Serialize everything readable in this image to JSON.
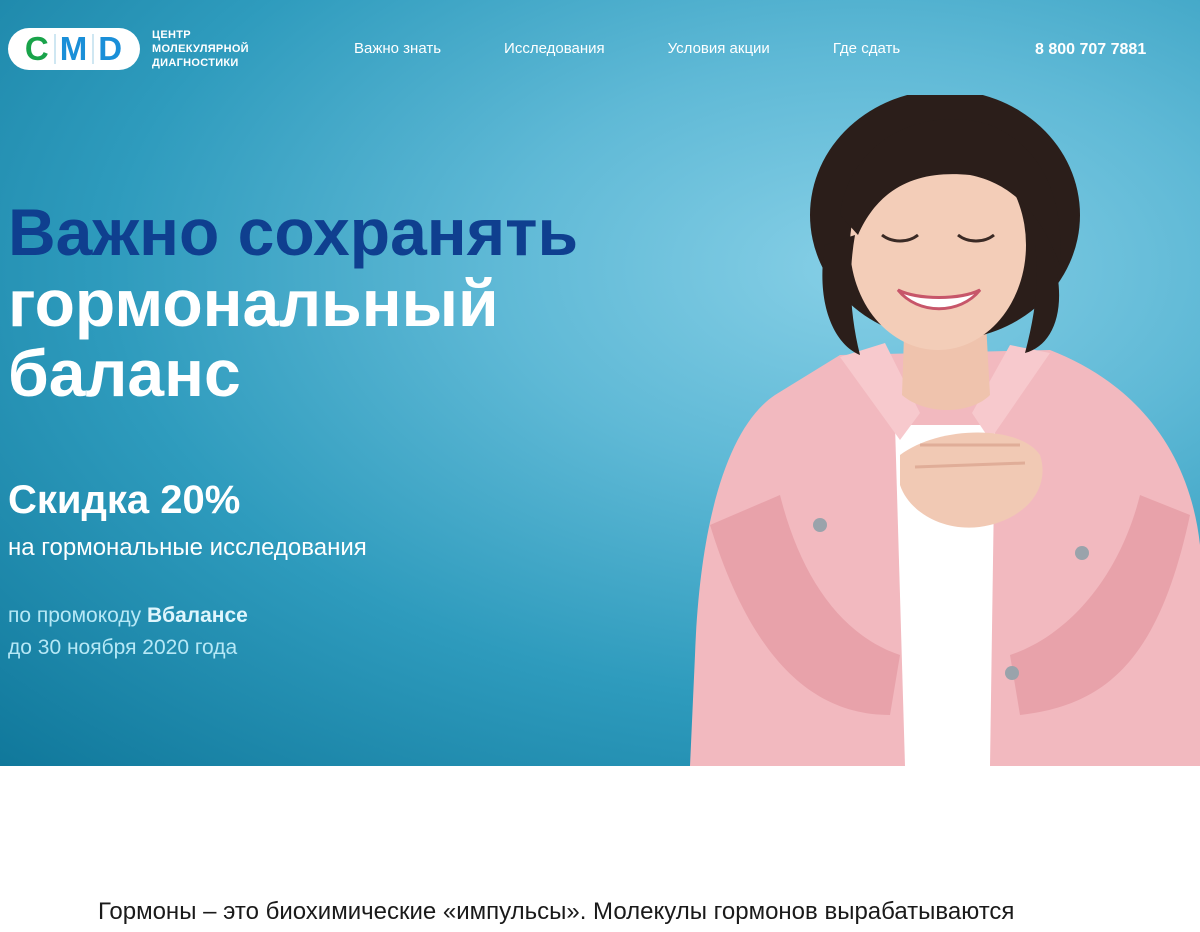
{
  "header": {
    "logo": {
      "letters": [
        "C",
        "M",
        "D"
      ],
      "lines": [
        "ЦЕНТР",
        "МОЛЕКУЛЯРНОЙ",
        "ДИАГНОСТИКИ"
      ]
    },
    "nav": [
      "Важно знать",
      "Исследования",
      "Условия акции",
      "Где сдать"
    ],
    "phone": "8 800 707 7881"
  },
  "hero": {
    "title_line1": "Важно сохранять",
    "title_line2": "гормональный баланс",
    "discount": "Скидка 20%",
    "discount_sub": "на гормональные исследования",
    "promo_prefix": "по промокоду ",
    "promo_code": "Вбалансе",
    "promo_deadline": "до 30 ноября 2020 года",
    "photo": "smiling-woman-photo"
  },
  "content": {
    "intro": "Гормоны – это биохимические «импульсы». Молекулы гормонов вырабатываются"
  },
  "colors": {
    "hero_bg": "#3ea8c9",
    "title_blue": "#0f3f8f",
    "logo_green": "#19a34a",
    "logo_blue": "#1a8fd8"
  }
}
